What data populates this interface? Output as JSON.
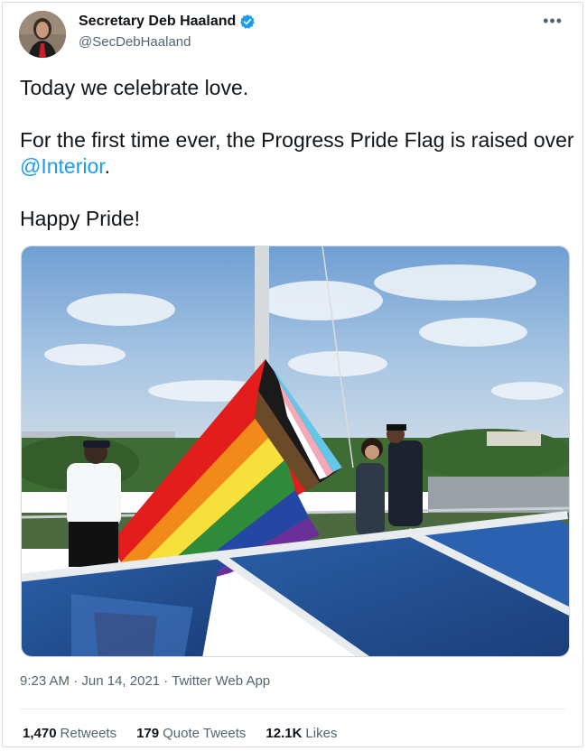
{
  "tweet": {
    "author": {
      "display_name": "Secretary Deb Haaland",
      "handle": "@SecDebHaaland",
      "verified": true,
      "avatar_icon": "profile-photo"
    },
    "more_icon": "•••",
    "text": {
      "line1": "Today we celebrate love.",
      "line2_prefix": "For the first time ever, the Progress Pride Flag is raised over ",
      "line2_mention": "@Interior",
      "line2_suffix": ".",
      "line3": "Happy Pride!"
    },
    "media_alt": "Progress Pride Flag being raised on a rooftop",
    "timestamp": {
      "time": "9:23 AM",
      "separator": " · ",
      "date": "Jun 14, 2021",
      "source": "Twitter Web App"
    },
    "stats": {
      "retweets_count": "1,470",
      "retweets_label": "Retweets",
      "quotes_count": "179",
      "quotes_label": "Quote Tweets",
      "likes_count": "12.1K",
      "likes_label": "Likes"
    }
  },
  "colors": {
    "link": "#1d9bf0",
    "secondary_text": "#536471",
    "primary_text": "#0f1419"
  }
}
